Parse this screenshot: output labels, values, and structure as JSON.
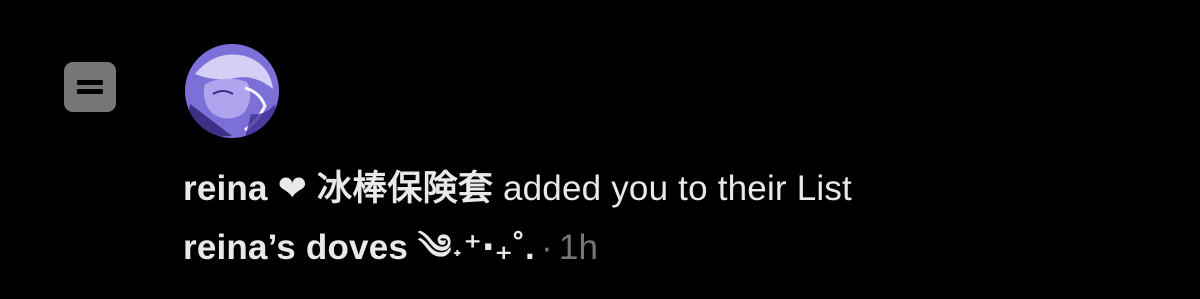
{
  "notification": {
    "user_display_name": "reina ❤ 冰棒保険套",
    "action_text": "added you to their List",
    "list_name": "reina’s doves ༄˖⁺‧₊˚.",
    "separator": "·",
    "timestamp": "1h"
  },
  "icons": {
    "list_icon": "list-icon",
    "avatar": "user-avatar"
  },
  "colors": {
    "background": "#000000",
    "primary_text": "#e7e9ea",
    "secondary_text": "#71767b",
    "list_icon_bg": "#767676"
  }
}
